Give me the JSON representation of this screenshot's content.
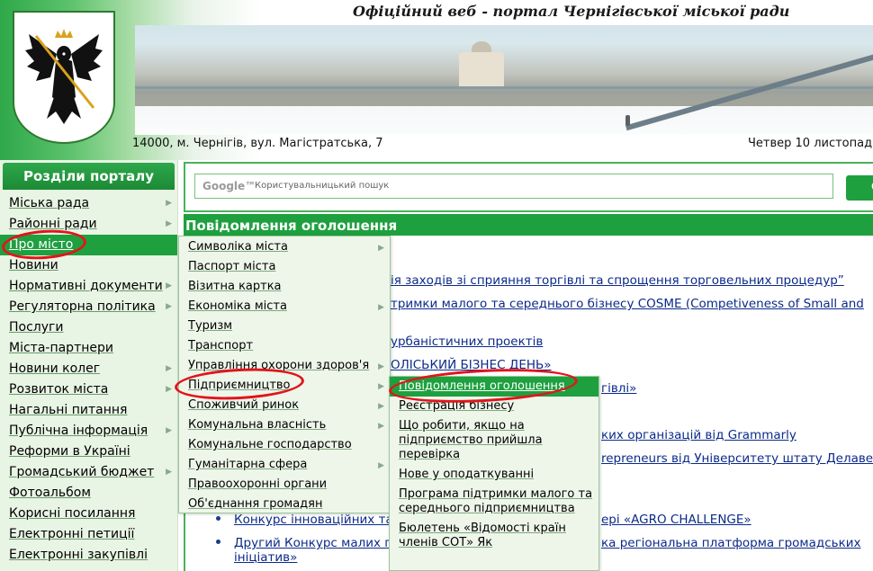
{
  "header": {
    "portal_title": "Офіційний веб - портал Чернігівської міської ради",
    "address": "14000, м. Чернігів, вул. Магістратська, 7",
    "date": "Четвер 10 листопад"
  },
  "sidebar": {
    "title": "Розділи порталу",
    "items": [
      {
        "label": "Міська рада",
        "has_submenu": true
      },
      {
        "label": "Районні ради",
        "has_submenu": true
      },
      {
        "label": "Про місто",
        "has_submenu": false,
        "active": true
      },
      {
        "label": "Новини",
        "has_submenu": false
      },
      {
        "label": "Нормативні документи",
        "has_submenu": true
      },
      {
        "label": "Регуляторна політика",
        "has_submenu": true
      },
      {
        "label": "Послуги",
        "has_submenu": false
      },
      {
        "label": "Міста-партнери",
        "has_submenu": false
      },
      {
        "label": "Новини колег",
        "has_submenu": true
      },
      {
        "label": "Розвиток міста",
        "has_submenu": true
      },
      {
        "label": "Нагальні питання",
        "has_submenu": false
      },
      {
        "label": "Публічна інформація",
        "has_submenu": true
      },
      {
        "label": "Реформи в Україні",
        "has_submenu": false
      },
      {
        "label": "Громадський бюджет",
        "has_submenu": true
      },
      {
        "label": "Фотоальбом",
        "has_submenu": false
      },
      {
        "label": "Корисні посилання",
        "has_submenu": false
      },
      {
        "label": "Електронні петиції",
        "has_submenu": false
      },
      {
        "label": "Електронні закупівлі",
        "has_submenu": false
      }
    ]
  },
  "search": {
    "logo": "Google™",
    "placeholder": "Користувальницький пошук",
    "button_label": "С"
  },
  "main": {
    "section_title": "Повідомлення оголошення",
    "lines": [
      "ія заходів зі сприяння торгівлі та спрощення торговельних процедур”",
      "тримки малого та середнього бізнесу COSME (Competiveness of Small and",
      "урбаністичних проектів",
      "ОЛІСЬКИЙ БІЗНЕС ДЕНЬ»",
      "гівлі»",
      "ких організацій від Grammarly",
      "repreneurs від Університету штату Делавер",
      "Конкурс інноваційних та",
      "ері «AGRO CHALLENGE»",
      "Другий Конкурс малих г",
      "ка регіональна платформа громадських",
      "ініціатив»"
    ]
  },
  "submenu_about": {
    "items": [
      {
        "label": "Символіка міста",
        "has_submenu": true
      },
      {
        "label": "Паспорт міста",
        "has_submenu": false
      },
      {
        "label": "Візитна картка",
        "has_submenu": false
      },
      {
        "label": "Економіка міста",
        "has_submenu": true
      },
      {
        "label": "Туризм",
        "has_submenu": false
      },
      {
        "label": "Транспорт",
        "has_submenu": false
      },
      {
        "label": "Управління охорони здоров'я",
        "has_submenu": true
      },
      {
        "label": "Підприємництво",
        "has_submenu": true
      },
      {
        "label": "Споживчий ринок",
        "has_submenu": true
      },
      {
        "label": "Комунальна власність",
        "has_submenu": true
      },
      {
        "label": "Комунальне господарство",
        "has_submenu": false
      },
      {
        "label": "Гуманітарна сфера",
        "has_submenu": true
      },
      {
        "label": "Правоохоронні органи",
        "has_submenu": false
      },
      {
        "label": "Об'єднання громадян",
        "has_submenu": false
      }
    ]
  },
  "submenu_business": {
    "items": [
      {
        "label": "Повідомлення оголошення",
        "active": true
      },
      {
        "label": "Реєстрація бізнесу"
      },
      {
        "label": "Що робити, якщо на підприємство прийшла перевірка"
      },
      {
        "label": "Нове у оподаткуванні"
      },
      {
        "label": "Програма підтримки малого та середнього підприємництва"
      },
      {
        "label": "Бюлетень «Відомості країн членів СОТ» Як"
      }
    ]
  },
  "colors": {
    "accent_green": "#1ea03f",
    "link_blue": "#0b2a8a",
    "annotation_red": "#e3141b"
  }
}
